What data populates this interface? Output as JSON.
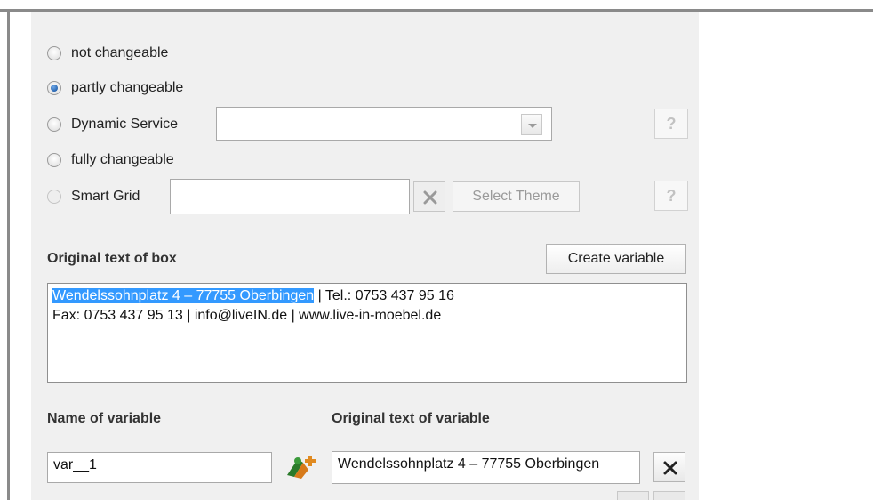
{
  "mode_options": [
    {
      "label": "not changeable",
      "checked": false,
      "disabled": false
    },
    {
      "label": "partly changeable",
      "checked": true,
      "disabled": false
    },
    {
      "label": "Dynamic Service",
      "checked": false,
      "disabled": false
    },
    {
      "label": "fully changeable",
      "checked": false,
      "disabled": false
    },
    {
      "label": "Smart Grid",
      "checked": false,
      "disabled": true
    }
  ],
  "dynamic_service": {
    "value": ""
  },
  "smart_grid": {
    "value": "",
    "select_theme_label": "Select Theme"
  },
  "help_label": "?",
  "original_text": {
    "heading": "Original text of box",
    "create_variable_label": "Create variable",
    "line1_selected": "Wendelssohnplatz 4 – 77755 Oberbingen",
    "line1_rest": " | Tel.: 0753 437 95 16",
    "line2": "Fax: 0753 437 95 13 | info@liveIN.de | www.live-in-moebel.de"
  },
  "variable": {
    "name_heading": "Name of variable",
    "text_heading": "Original text of variable",
    "name_value": "var__1",
    "text_value": "Wendelssohnplatz 4 – 77755 Oberbingen"
  },
  "colors": {
    "selection": "#3399ff",
    "panel_bg": "#f0f0f0"
  }
}
